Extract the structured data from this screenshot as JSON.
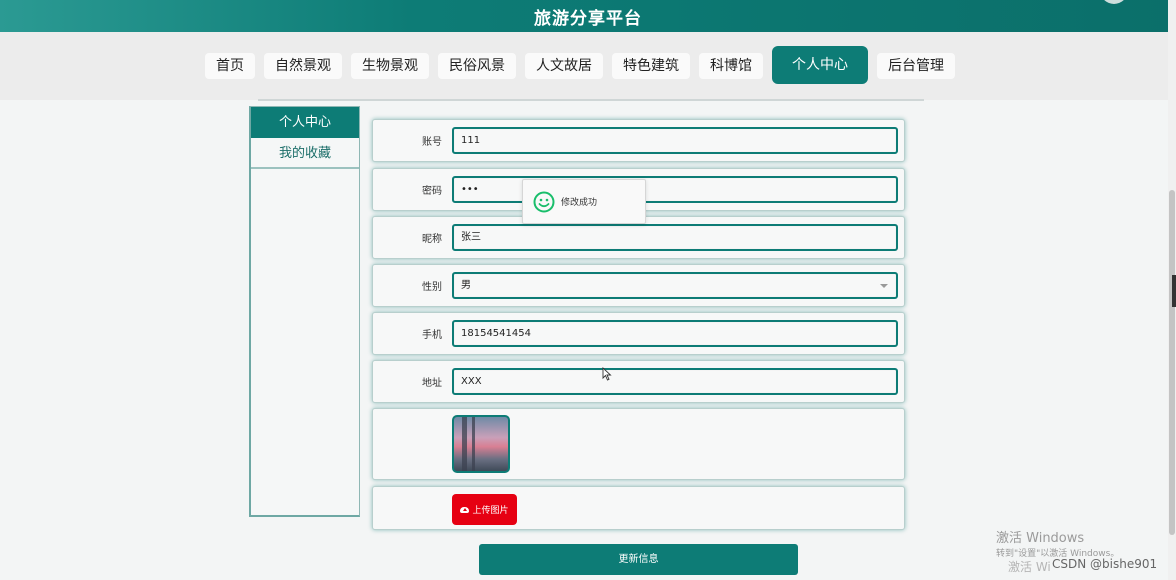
{
  "header": {
    "title": "旅游分享平台"
  },
  "nav": {
    "items": [
      "首页",
      "自然景观",
      "生物景观",
      "民俗风景",
      "人文故居",
      "特色建筑",
      "科博馆",
      "个人中心",
      "后台管理"
    ],
    "active_index": 7
  },
  "sidebar": {
    "items": [
      "个人中心",
      "我的收藏"
    ]
  },
  "form": {
    "account": {
      "label": "账号",
      "value": "111"
    },
    "password": {
      "label": "密码",
      "value": "•••"
    },
    "nickname": {
      "label": "昵称",
      "value": "张三"
    },
    "gender": {
      "label": "性别",
      "value": "男"
    },
    "phone": {
      "label": "手机",
      "value": "18154541454"
    },
    "address": {
      "label": "地址",
      "value": "XXX"
    },
    "upload_label": "上传图片",
    "submit_label": "更新信息"
  },
  "toast": {
    "message": "修改成功",
    "icon": "smiley-icon"
  },
  "watermark": {
    "line1": "激活 Windows",
    "line2": "转到\"设置\"以激活 Windows。",
    "line3": "激活 Wi",
    "credit": "CSDN @bishe901"
  },
  "colors": {
    "primary": "#0d7c76",
    "upload": "#e60012",
    "success": "#19be6b"
  }
}
